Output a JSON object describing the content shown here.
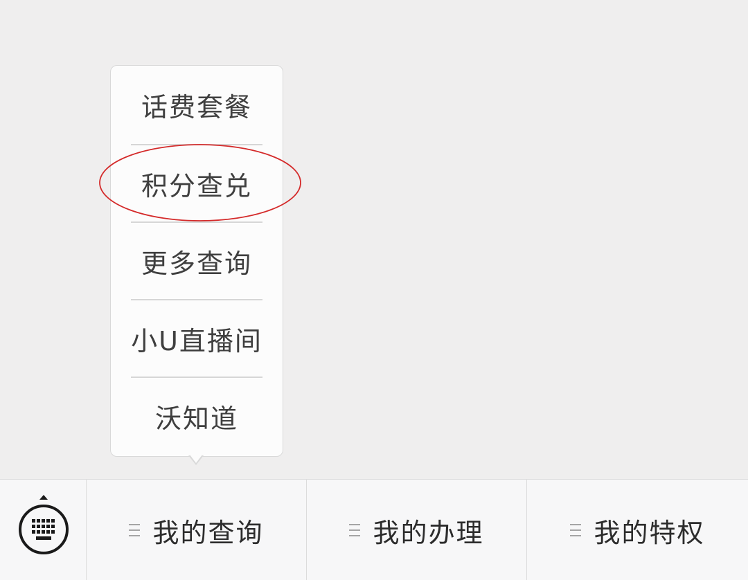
{
  "submenu": {
    "items": [
      {
        "label": "话费套餐"
      },
      {
        "label": "积分查兑"
      },
      {
        "label": "更多查询"
      },
      {
        "label": "小U直播间"
      },
      {
        "label": "沃知道"
      }
    ],
    "highlighted_index": 1,
    "highlight_color": "#d42a2a"
  },
  "bottom_menu": {
    "keyboard_icon": "keyboard-icon",
    "tabs": [
      {
        "label": "我的查询",
        "icon": "menu-lines-icon"
      },
      {
        "label": "我的办理",
        "icon": "menu-lines-icon"
      },
      {
        "label": "我的特权",
        "icon": "menu-lines-icon"
      }
    ]
  }
}
